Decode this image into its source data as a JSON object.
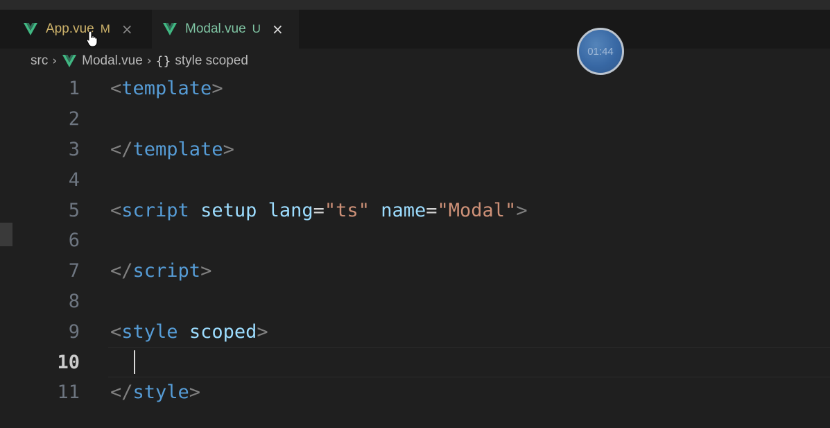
{
  "tabs": [
    {
      "label": "App.vue",
      "status": "M",
      "close": "×"
    },
    {
      "label": "Modal.vue",
      "status": "U",
      "close": "×"
    }
  ],
  "timer": "01:44",
  "breadcrumb": {
    "root": "src",
    "file": "Modal.vue",
    "symbol_icon": "{}",
    "symbol": "style scoped"
  },
  "lines": [
    {
      "num": "1",
      "open": "<",
      "tag": "template",
      "close": ">"
    },
    {
      "num": "2"
    },
    {
      "num": "3",
      "open": "</",
      "tag": "template",
      "close": ">"
    },
    {
      "num": "4"
    },
    {
      "num": "5",
      "open": "<",
      "tag": "script",
      "attr1": "setup",
      "attr2": "lang",
      "eq": "=",
      "val2": "\"ts\"",
      "attr3": "name",
      "val3": "\"Modal\"",
      "close": ">"
    },
    {
      "num": "6"
    },
    {
      "num": "7",
      "open": "</",
      "tag": "script",
      "close": ">"
    },
    {
      "num": "8"
    },
    {
      "num": "9",
      "open": "<",
      "tag": "style",
      "attr1": "scoped",
      "close": ">"
    },
    {
      "num": "10"
    },
    {
      "num": "11",
      "open": "</",
      "tag": "style",
      "close": ">"
    }
  ],
  "colors": {
    "tag": "#569cd6",
    "attribute": "#9cdcfe",
    "string": "#ce9178",
    "modified": "#cdb26a",
    "untracked": "#7fc4a3"
  },
  "icons": {
    "file": "vue-icon",
    "close": "close-icon",
    "pointer": "mouse-pointer-icon"
  }
}
